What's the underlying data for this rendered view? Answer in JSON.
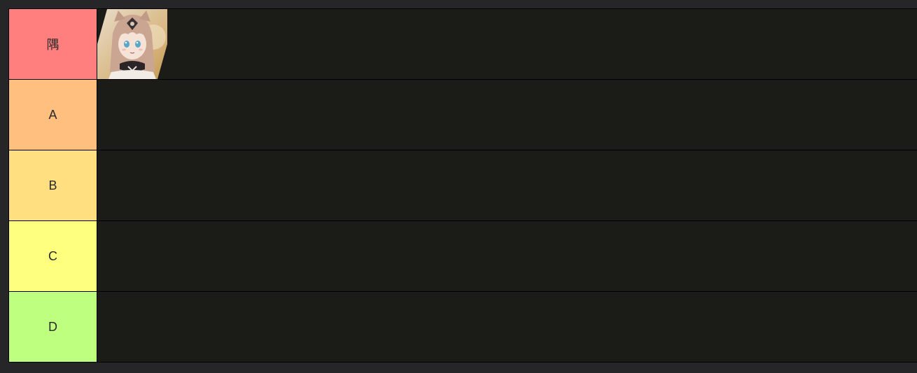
{
  "tiers": [
    {
      "label": "隅",
      "color": "#ff7f7f",
      "items": [
        {
          "name": "cat-ear-girl-portrait"
        }
      ]
    },
    {
      "label": "A",
      "color": "#ffbf7f",
      "items": []
    },
    {
      "label": "B",
      "color": "#ffdf7f",
      "items": []
    },
    {
      "label": "C",
      "color": "#ffff7f",
      "items": []
    },
    {
      "label": "D",
      "color": "#bfff7f",
      "items": []
    }
  ]
}
